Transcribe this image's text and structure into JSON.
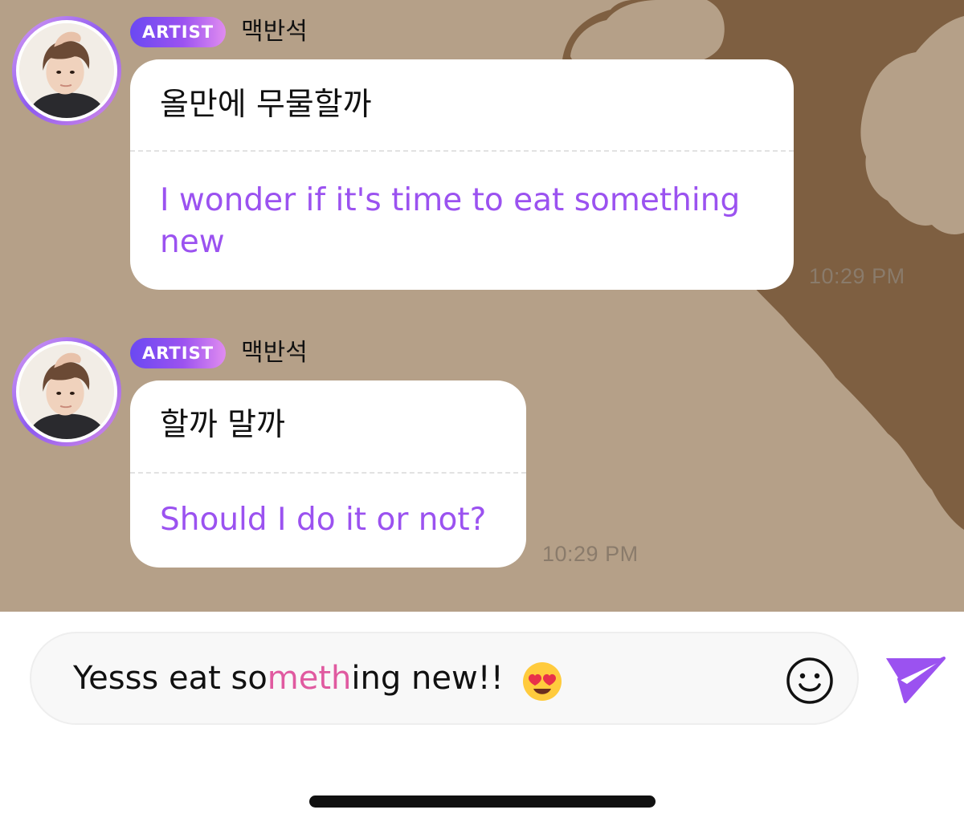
{
  "messages": [
    {
      "badge": "ARTIST",
      "sender": "맥반석",
      "original": "올만에 무물할까",
      "translation_line1": "I wonder if it's time to eat something",
      "translation_line2": "new",
      "time": "10:29 PM"
    },
    {
      "badge": "ARTIST",
      "sender": "맥반석",
      "original": "할까 말까",
      "translation_line1": "Should I do it or not?",
      "time": "10:29 PM"
    }
  ],
  "composer": {
    "text_part1": "Yesss eat so",
    "text_highlight": "meth",
    "text_part2": "ing new!!",
    "inline_emoji": "smiling-face-with-heart-eyes",
    "emoji_button_icon": "smiley-face-icon",
    "send_button_icon": "paper-plane-icon"
  },
  "colors": {
    "chat_background": "#b5a088",
    "chat_background_dark": "#7e5f41",
    "accent_purple": "#9b52f0",
    "highlight_pink": "#e05aa0"
  }
}
